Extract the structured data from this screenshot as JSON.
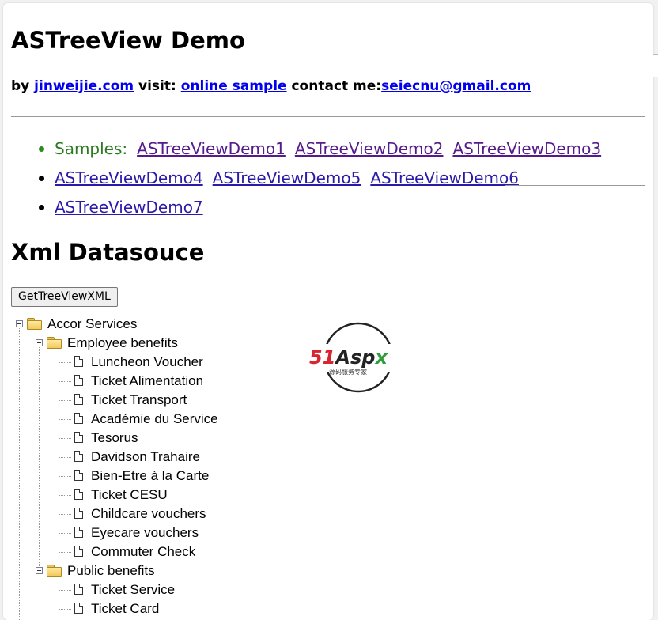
{
  "header": {
    "title": "ASTreeView Demo",
    "by_label": "by ",
    "author_link": "jinweijie.com",
    "visit_label": " visit: ",
    "online_link": "online sample",
    "contact_label": " contact me:",
    "email_link": "seiecnu@gmail.com"
  },
  "samples": {
    "label": "Samples:",
    "links": [
      "ASTreeViewDemo1",
      "ASTreeViewDemo2",
      "ASTreeViewDemo3",
      "ASTreeViewDemo4",
      "ASTreeViewDemo5",
      "ASTreeViewDemo6",
      "ASTreeViewDemo7"
    ]
  },
  "section": {
    "title": "Xml Datasouce",
    "button_label": "GetTreeViewXML"
  },
  "tree": {
    "root": "Accor Services",
    "groups": [
      {
        "label": "Employee benefits",
        "items": [
          "Luncheon Voucher",
          "Ticket Alimentation",
          "Ticket Transport",
          "Académie du Service",
          "Tesorus",
          "Davidson Trahaire",
          "Bien-Etre à la Carte",
          "Ticket CESU",
          "Childcare vouchers",
          "Eyecare vouchers",
          "Commuter Check"
        ]
      },
      {
        "label": "Public benefits",
        "items": [
          "Ticket Service",
          "Ticket Card"
        ]
      }
    ]
  },
  "logo": {
    "brand": "51Aspx",
    "tagline": "源码服务专家",
    "colors": {
      "red": "#d9232e",
      "green": "#2e9e3a",
      "ring": "#222222"
    }
  }
}
